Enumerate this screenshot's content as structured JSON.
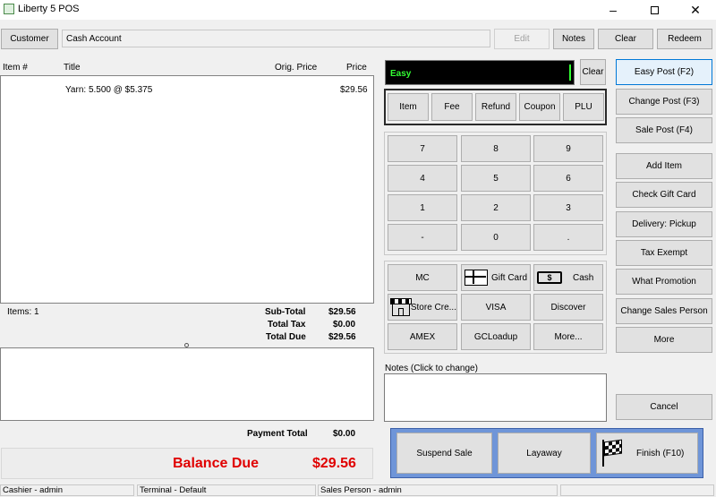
{
  "window": {
    "title": "Liberty 5 POS"
  },
  "topbar": {
    "customer_label": "Customer",
    "account_value": "Cash Account",
    "edit_label": "Edit",
    "notes_label": "Notes",
    "clear_label": "Clear",
    "redeem_label": "Redeem"
  },
  "grid": {
    "columns": [
      "Item #",
      "Title",
      "Orig. Price",
      "Price"
    ],
    "rows": [
      {
        "item": "",
        "title": "Yarn: 5.500 @ $5.375",
        "orig_price": "",
        "price": "$29.56"
      }
    ]
  },
  "totals": {
    "items_label": "Items: 1",
    "subtotal_label": "Sub-Total",
    "subtotal_value": "$29.56",
    "tax_label": "Total Tax",
    "tax_value": "$0.00",
    "due_label": "Total Due",
    "due_value": "$29.56",
    "payment_label": "Payment Total",
    "payment_value": "$0.00",
    "balance_label": "Balance Due",
    "balance_value": "$29.56"
  },
  "entry": {
    "mode": "Easy",
    "clear_label": "Clear"
  },
  "type_buttons": [
    "Item",
    "Fee",
    "Refund",
    "Coupon",
    "PLU"
  ],
  "keypad": [
    "7",
    "8",
    "9",
    "4",
    "5",
    "6",
    "1",
    "2",
    "3",
    "-",
    "0",
    "."
  ],
  "tenders": [
    "MC",
    "Gift Card",
    "Cash",
    "Store Cre...",
    "VISA",
    "Discover",
    "AMEX",
    "GCLoadup",
    "More..."
  ],
  "notes": {
    "label": "Notes (Click to change)"
  },
  "actions": {
    "easy_post": "Easy Post (F2)",
    "change_post": "Change Post (F3)",
    "sale_post": "Sale Post (F4)",
    "add_item": "Add Item",
    "check_gift_card": "Check Gift Card",
    "delivery": "Delivery: Pickup",
    "tax_exempt": "Tax Exempt",
    "what_promotion": "What Promotion",
    "change_sales_person": "Change Sales Person",
    "more": "More",
    "cancel": "Cancel"
  },
  "bottom": {
    "suspend": "Suspend Sale",
    "layaway": "Layaway",
    "finish": "Finish (F10)"
  },
  "status": {
    "cashier": "Cashier - admin",
    "terminal": "Terminal - Default",
    "sales_person": "Sales Person - admin"
  },
  "colors": {
    "balance": "#e00000",
    "accent": "#0078d7",
    "easy_text": "#33ff33",
    "bottom_panel": "#6f95d8"
  }
}
